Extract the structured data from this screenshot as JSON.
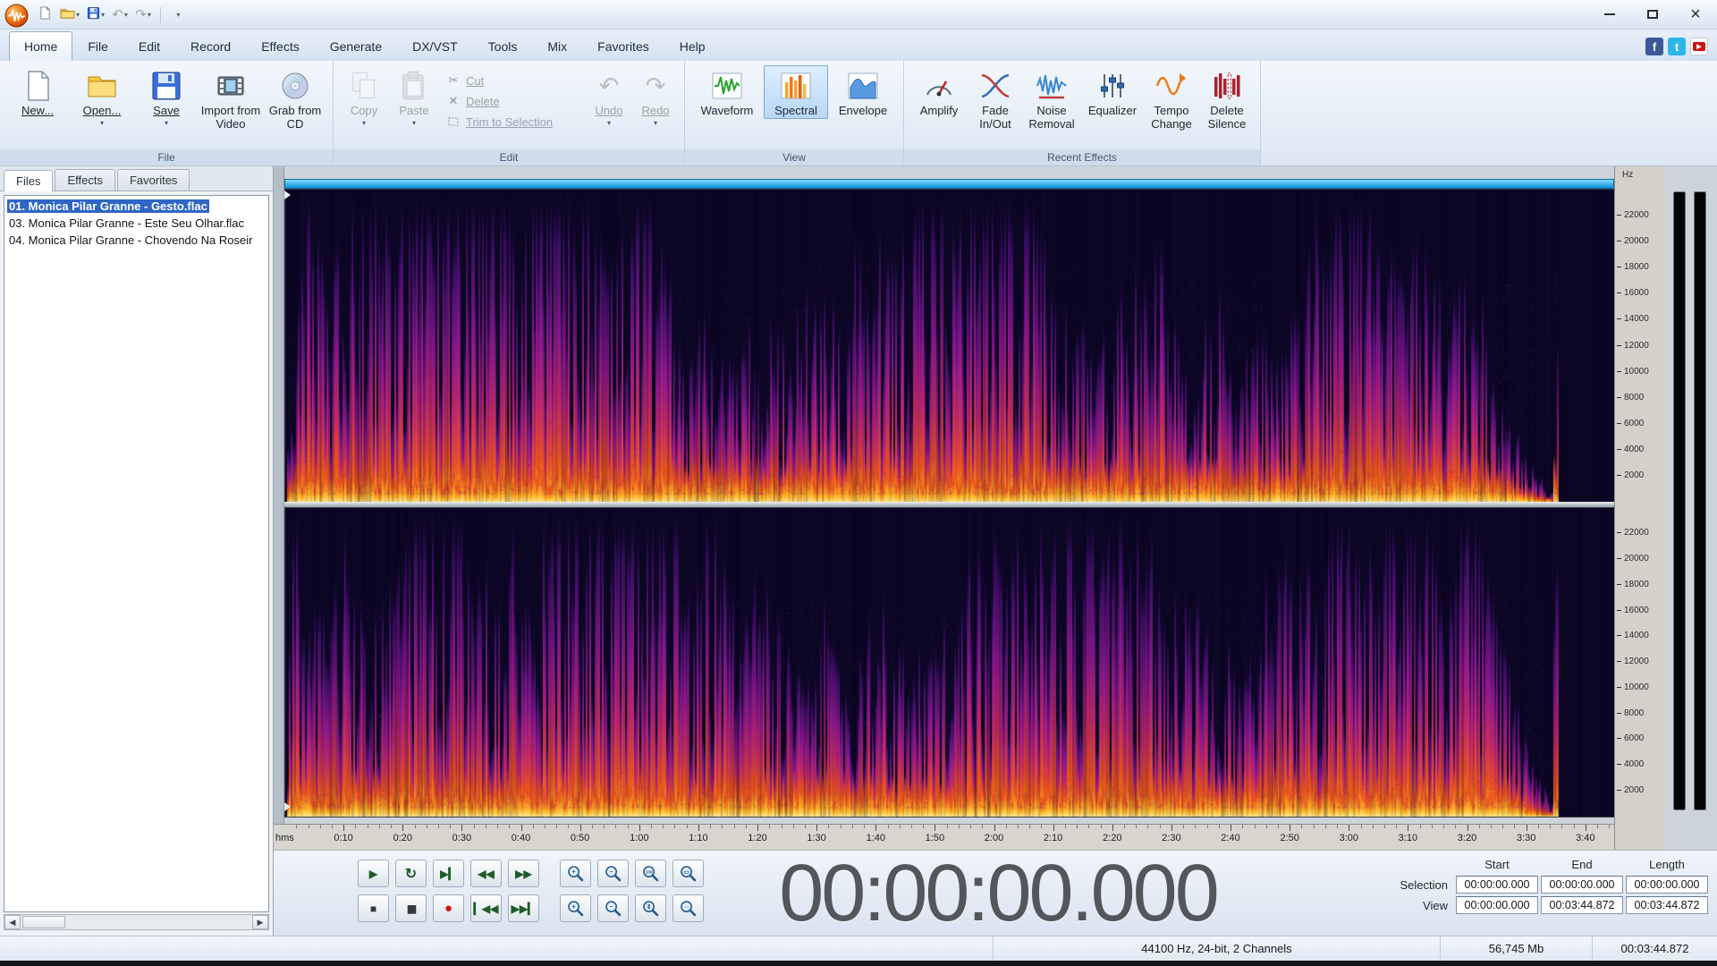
{
  "titlebar": {
    "minimize_glyph": "–",
    "maximize_glyph": "❐",
    "close_glyph": "×"
  },
  "glyphs": {
    "caret": "▾",
    "undo": "↶",
    "redo": "↷",
    "cut": "✂",
    "delete": "✕",
    "scroll_left": "◀",
    "scroll_right": "▶"
  },
  "ribbon_tabs": [
    {
      "label": "Home",
      "active": true
    },
    {
      "label": "File"
    },
    {
      "label": "Edit"
    },
    {
      "label": "Record"
    },
    {
      "label": "Effects"
    },
    {
      "label": "Generate"
    },
    {
      "label": "DX/VST"
    },
    {
      "label": "Tools"
    },
    {
      "label": "Mix"
    },
    {
      "label": "Favorites"
    },
    {
      "label": "Help"
    }
  ],
  "social": {
    "facebook": "f",
    "twitter": "t"
  },
  "ribbon": {
    "groups": {
      "file": {
        "label": "File",
        "buttons": {
          "new": {
            "label": "New..."
          },
          "open": {
            "label": "Open..."
          },
          "save": {
            "label": "Save"
          },
          "import_video": {
            "label": "Import from Video"
          },
          "grab_cd": {
            "label": "Grab from CD"
          }
        }
      },
      "edit": {
        "label": "Edit",
        "buttons": {
          "copy": {
            "label": "Copy"
          },
          "paste": {
            "label": "Paste"
          },
          "cut": {
            "label": "Cut"
          },
          "delete": {
            "label": "Delete"
          },
          "trim": {
            "label": "Trim to Selection"
          },
          "undo": {
            "label": "Undo"
          },
          "redo": {
            "label": "Redo"
          }
        }
      },
      "view": {
        "label": "View",
        "buttons": {
          "waveform": {
            "label": "Waveform"
          },
          "spectral": {
            "label": "Spectral",
            "selected": true
          },
          "envelope": {
            "label": "Envelope"
          }
        }
      },
      "recent_effects": {
        "label": "Recent Effects",
        "buttons": {
          "amplify": {
            "label": "Amplify"
          },
          "fade": {
            "label": "Fade In/Out"
          },
          "noise": {
            "label": "Noise Removal"
          },
          "equalizer": {
            "label": "Equalizer"
          },
          "tempo": {
            "label": "Tempo Change"
          },
          "delete_silence": {
            "label": "Delete Silence"
          }
        }
      }
    }
  },
  "sidebar": {
    "tabs": [
      {
        "label": "Files",
        "active": true
      },
      {
        "label": "Effects"
      },
      {
        "label": "Favorites"
      }
    ],
    "files": [
      {
        "label": "01. Monica Pilar Granne - Gesto.flac",
        "selected": true
      },
      {
        "label": "03. Monica Pilar Granne - Este Seu Olhar.flac"
      },
      {
        "label": "04. Monica Pilar Granne - Chovendo Na Roseir"
      }
    ]
  },
  "timeline": {
    "unit": "hms",
    "duration_seconds": 224.872,
    "ticks": [
      "0:10",
      "0:20",
      "0:30",
      "0:40",
      "0:50",
      "1:00",
      "1:10",
      "1:20",
      "1:30",
      "1:40",
      "1:50",
      "2:00",
      "2:10",
      "2:20",
      "2:30",
      "2:40",
      "2:50",
      "3:00",
      "3:10",
      "3:20",
      "3:30",
      "3:40"
    ]
  },
  "frequency_axis": {
    "unit": "Hz",
    "labels": [
      "22000",
      "20000",
      "18000",
      "16000",
      "14000",
      "12000",
      "10000",
      "8000",
      "6000",
      "4000",
      "2000"
    ]
  },
  "transport": {
    "row1": [
      "play",
      "loop",
      "play-to-end",
      "rewind",
      "fast-forward"
    ],
    "row2": [
      "stop",
      "pause",
      "record",
      "go-to-start",
      "go-to-end"
    ],
    "glyphs": {
      "play": "▶",
      "loop": "↻",
      "play-to-end": "▶▎",
      "rewind": "◀◀",
      "fast-forward": "▶▶",
      "stop": "■",
      "pause": "▮▮",
      "record": "●",
      "go-to-start": "▎◀◀",
      "go-to-end": "▶▶▎"
    },
    "zoom_row1": [
      "zoom-in",
      "zoom-out",
      "zoom-100",
      "zoom-selection"
    ],
    "zoom_row2": [
      "zoom-vertical-in",
      "zoom-vertical-out",
      "zoom-level",
      "zoom-full"
    ],
    "zoom_mods": {
      "zoom-in": "+",
      "zoom-out": "−",
      "zoom-100": "100",
      "zoom-selection": "▭",
      "zoom-vertical-in": "+",
      "zoom-vertical-out": "−",
      "zoom-level": "⇕",
      "zoom-full": "⇔"
    }
  },
  "time_display": {
    "value": "00:00:00.000"
  },
  "position_panel": {
    "columns": [
      "Start",
      "End",
      "Length"
    ],
    "rows": [
      {
        "label": "Selection",
        "values": [
          "00:00:00.000",
          "00:00:00.000",
          "00:00:00.000"
        ]
      },
      {
        "label": "View",
        "values": [
          "00:00:00.000",
          "00:03:44.872",
          "00:03:44.872"
        ]
      }
    ]
  },
  "status_bar": {
    "format": "44100 Hz, 24-bit, 2 Channels",
    "size": "56,745 Mb",
    "length": "00:03:44.872"
  },
  "colors": {
    "selection_blue": "#2f66c5",
    "view_bar_top": "#86dcff",
    "view_bar_bottom": "#0d8fd6",
    "spectrogram_bg": "#0c0724",
    "spectrogram_palette": [
      "#0c0724",
      "#4a1076",
      "#8c188c",
      "#c22a64",
      "#e85420",
      "#ffb020",
      "#ffe98e"
    ],
    "record_red": "#cf1212",
    "waveform_green": "#28a32c",
    "envelope_blue": "#5a9ae0"
  }
}
